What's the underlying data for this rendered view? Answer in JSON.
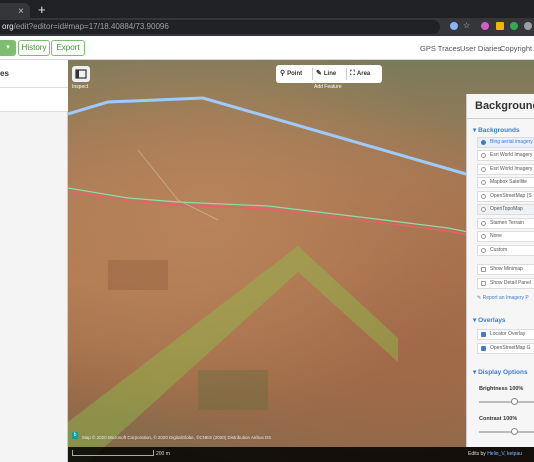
{
  "browser": {
    "new_tab": "+",
    "tab_close": "×",
    "url_host": "org",
    "url_path": "/edit?editor=id#map=17/18.40884/73.90096"
  },
  "toolbar": {
    "save_caret": "▾",
    "history_label": "History",
    "export_label": "Export",
    "gps_traces": "GPS Traces",
    "user_diaries": "User Diaries",
    "copyright": "Copyright"
  },
  "sidebar": {
    "title_fragment": "es"
  },
  "map": {
    "inspect_label": "Inspect",
    "modes": {
      "point": "Point",
      "line": "Line",
      "area": "Area",
      "caption": "Add Feature"
    },
    "attribution": "Map © 2020 Microsoft Corporation, © 2020 DigitalGlobe, ©CNES (2020) Distribution Airbus DS",
    "scale_label": "200 m",
    "edits_prefix": "Edits by",
    "edits_user": "Helio_V, ketpau"
  },
  "background_pane": {
    "title": "Backgrounds",
    "backgrounds_header": "Backgrounds",
    "sources": [
      {
        "label": "Bing aerial imagery",
        "selected": true
      },
      {
        "label": "Esri World Imagery",
        "selected": false
      },
      {
        "label": "Esri World Imagery",
        "selected": false
      },
      {
        "label": "Mapbox Satellite",
        "selected": false
      },
      {
        "label": "OpenStreetMap (S",
        "selected": false
      },
      {
        "label": "OpenTopoMap",
        "selected": false
      },
      {
        "label": "Stamen Terrain",
        "selected": false
      },
      {
        "label": "None",
        "selected": false
      },
      {
        "label": "Custom",
        "selected": false
      }
    ],
    "show_minimap": "Show Minimap",
    "show_detail_panel": "Show Detail Panel",
    "report_issue": "Report an Imagery P",
    "overlays_header": "Overlays",
    "overlays": [
      {
        "label": "Locator Overlay",
        "checked": true
      },
      {
        "label": "OpenStreetMap G",
        "checked": true
      }
    ],
    "display_header": "Display Options",
    "brightness_label": "Brightness 100%",
    "contrast_label": "Contrast 100%",
    "brightness_value": 1.0,
    "contrast_value": 1.0
  },
  "colors": {
    "accent_green": "#7ebc6f",
    "link_blue": "#3b7cd8",
    "road_line": "#9ecbff",
    "river_red": "#e8606a",
    "river_green": "#8fdcaa"
  }
}
